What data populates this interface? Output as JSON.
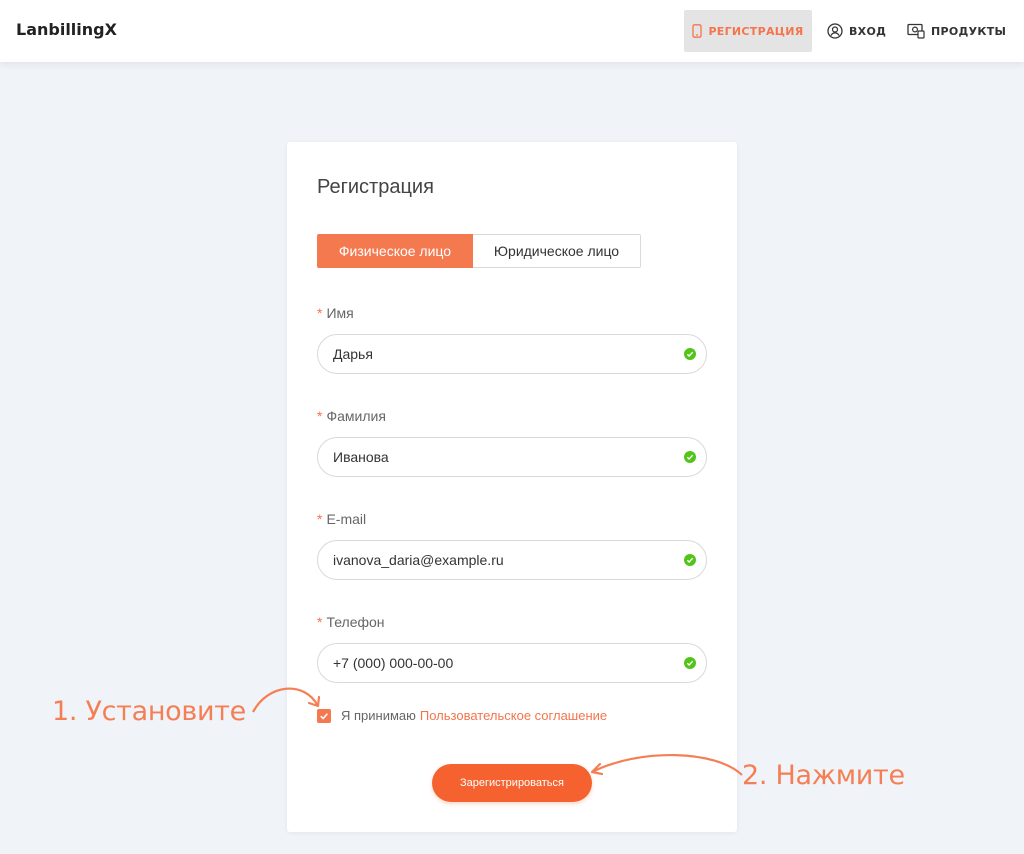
{
  "header": {
    "brand": "LanbillingX",
    "nav": {
      "register": "РЕГИСТРАЦИЯ",
      "login": "ВХОД",
      "products": "ПРОДУКТЫ"
    }
  },
  "card": {
    "title": "Регистрация",
    "tabs": {
      "person": "Физическое лицо",
      "company": "Юридическое лицо"
    },
    "fields": {
      "name": {
        "label": "Имя",
        "value": "Дарья"
      },
      "surname": {
        "label": "Фамилия",
        "value": "Иванова"
      },
      "email": {
        "label": "E-mail",
        "value": "ivanova_daria@example.ru"
      },
      "phone": {
        "label": "Телефон",
        "value": "+7 (000) 000-00-00"
      }
    },
    "required_mark": "*",
    "agree": {
      "text": "Я принимаю",
      "link": "Пользовательское соглашение",
      "checked": true
    },
    "submit_label": "Зарегистрироваться"
  },
  "annotations": {
    "step1": "1. Установите",
    "step2": "2. Нажмите"
  },
  "colors": {
    "accent": "#f5744c",
    "button": "#f5622f",
    "success": "#52c41a",
    "background": "#f0f4f9"
  }
}
